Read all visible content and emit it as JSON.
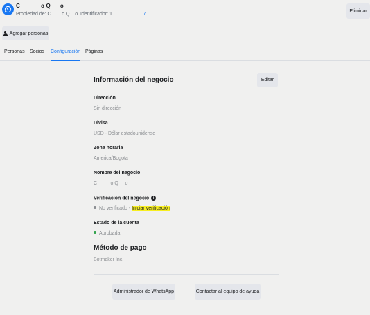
{
  "header": {
    "account_name_parts": [
      "C",
      "o Q",
      "o"
    ],
    "owned_by_label": "Propiedad de: C",
    "owned_by_tail": "o Q",
    "id_label": "o  Identificador: 1",
    "id_value": "7",
    "delete_button": "Eliminar",
    "add_people_button": "Agregar personas"
  },
  "tabs": [
    {
      "label": "Personas",
      "active": false
    },
    {
      "label": "Socios",
      "active": false
    },
    {
      "label": "Configuración",
      "active": true
    },
    {
      "label": "Páginas",
      "active": false
    }
  ],
  "business_info": {
    "title": "Información del negocio",
    "edit_button": "Editar",
    "address": {
      "label": "Dirección",
      "value": "Sin dirección"
    },
    "currency": {
      "label": "Divisa",
      "value": "USD - Dólar estadounidense"
    },
    "timezone": {
      "label": "Zona horaria",
      "value": "America/Bogota"
    },
    "business_name": {
      "label": "Nombre del negocio",
      "value": "C          o Q     o"
    },
    "verification": {
      "label": "Verificación del negocio",
      "status": "No verificado",
      "separator": " - ",
      "action": "Iniciar verificación",
      "status_color": "#8a8d91"
    },
    "account_status": {
      "label": "Estado de la cuenta",
      "value": "Aprobada",
      "status_color": "#31a24c"
    }
  },
  "payment": {
    "title": "Método de pago",
    "value": "Botmaker Inc."
  },
  "footer_buttons": {
    "whatsapp_manager": "Administrador de WhatsApp",
    "contact_support": "Contactar al equipo de ayuda"
  },
  "colors": {
    "accent": "#1877f2",
    "highlight": "#f7ee20",
    "background": "#f0f0ef"
  },
  "icons": [
    "whatsapp-logo-icon",
    "person-icon",
    "info-icon",
    "status-dot-icon"
  ]
}
